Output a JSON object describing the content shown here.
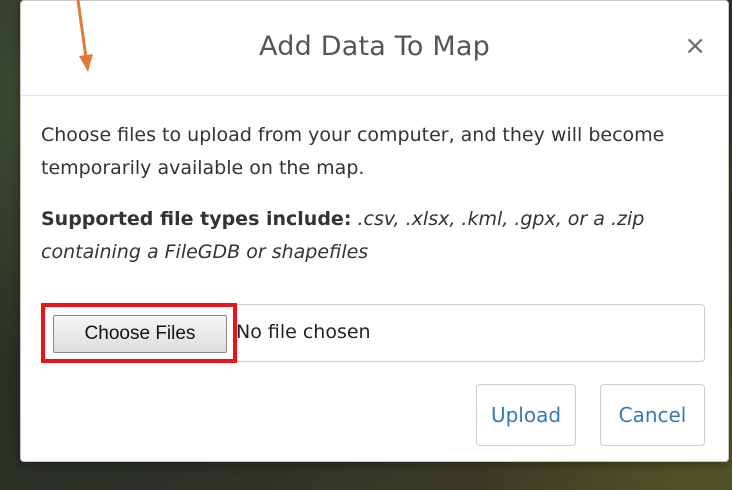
{
  "dialog": {
    "title": "Add Data To Map",
    "close_symbol": "×",
    "intro_text": "Choose files to upload from your computer, and they will become temporarily available on the map.",
    "types_label": "Supported file types include:",
    "types_list": ".csv, .xlsx, .kml, .gpx, or a .zip",
    "types_extra": "containing a FileGDB or shapefiles",
    "file_input": {
      "button_label": "Choose Files",
      "status_text": "No file chosen"
    },
    "buttons": {
      "upload_label": "Upload",
      "cancel_label": "Cancel"
    }
  },
  "colors": {
    "highlight_box": "#e8141a",
    "annotation_arrow": "#e07b39",
    "link_blue": "#337ab7"
  },
  "icons": {
    "close": "close-icon",
    "annotation": "arrow-annotation-icon"
  }
}
